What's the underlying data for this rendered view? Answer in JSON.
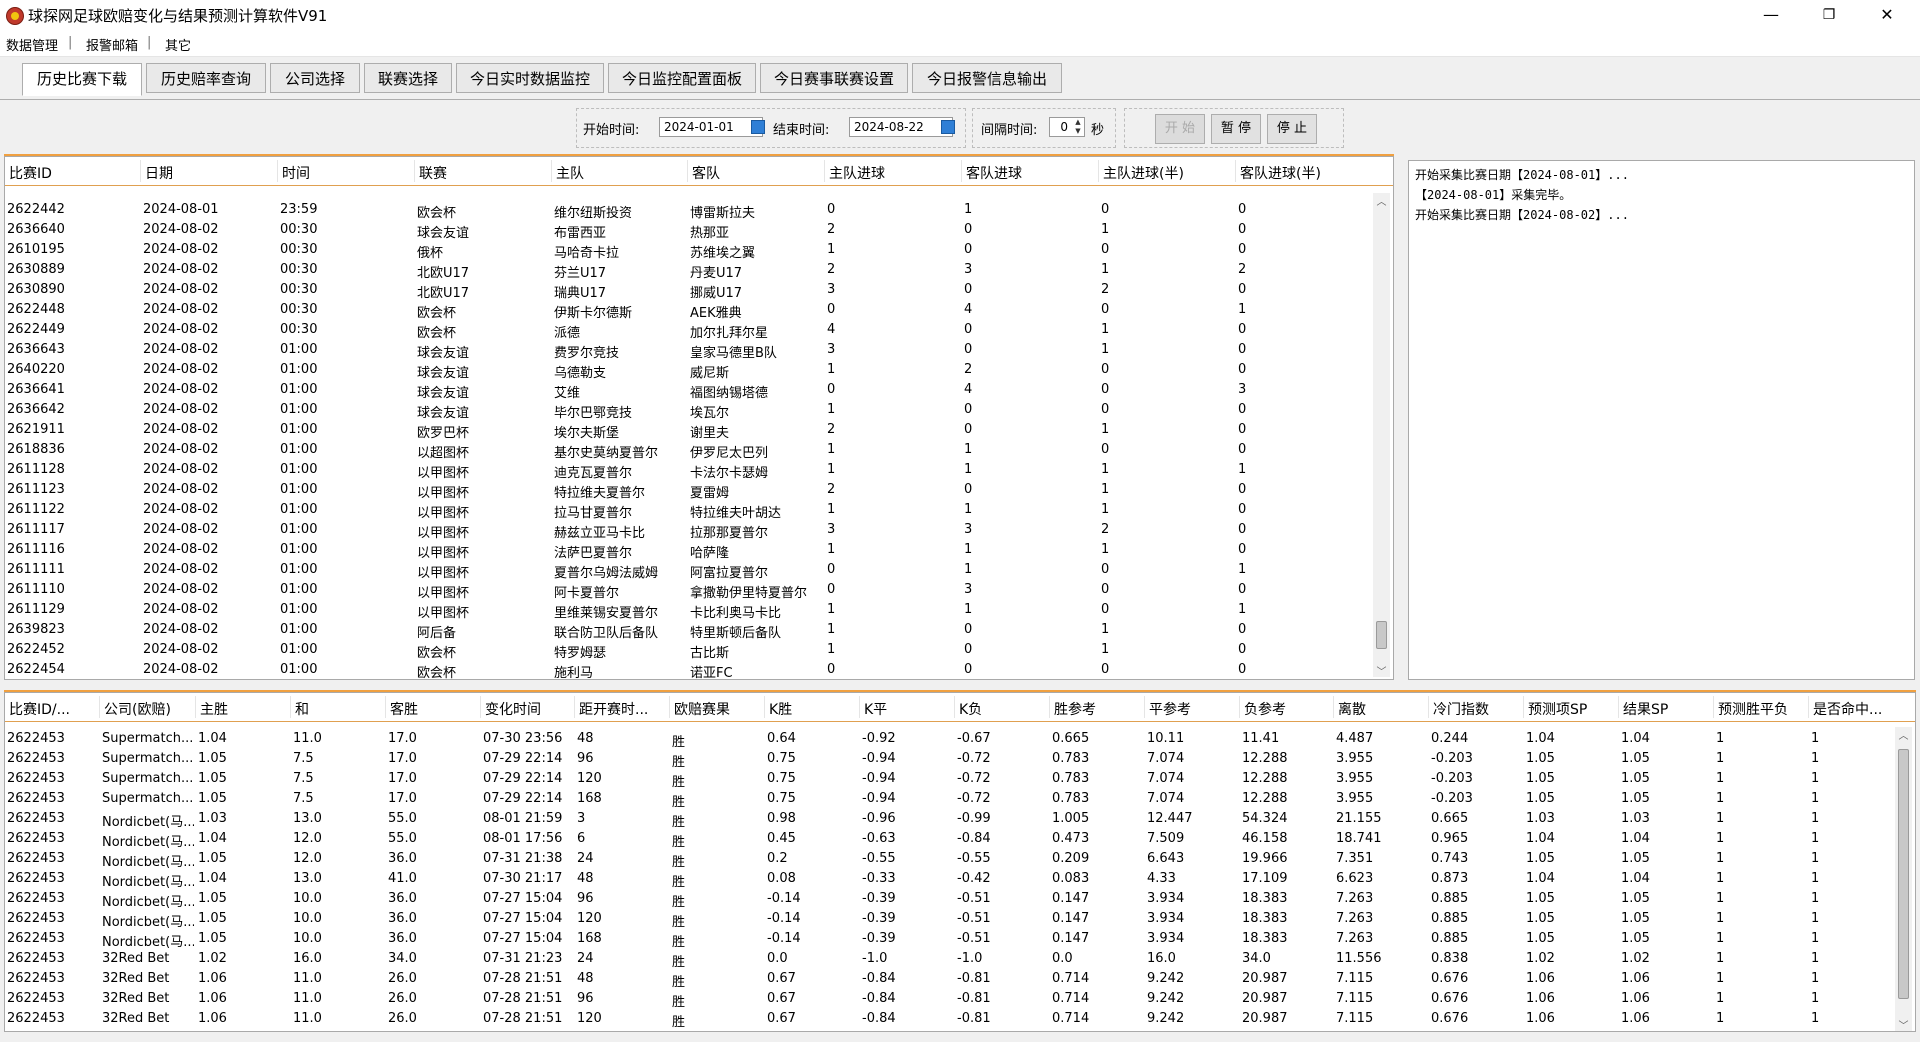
{
  "window": {
    "title": "球探网足球欧赔变化与结果预测计算软件V91",
    "minimize": "—",
    "maximize": "❐",
    "close": "✕"
  },
  "menu": [
    "数据管理",
    "报警邮箱",
    "其它"
  ],
  "menu_separator": "|",
  "tabs": [
    "历史比赛下载",
    "历史赔率查询",
    "公司选择",
    "联赛选择",
    "今日实时数据监控",
    "今日监控配置面板",
    "今日赛事联赛设置",
    "今日报警信息输出"
  ],
  "controls": {
    "start_label": "开始时间:",
    "start_date": "2024-01-01",
    "end_label": "结束时间:",
    "end_date": "2024-08-22",
    "interval_label": "间隔时间:",
    "interval_value": "0",
    "interval_unit": "秒",
    "start_button": "开 始",
    "pause_button": "暂 停",
    "stop_button": "停 止"
  },
  "matches": {
    "columns": [
      "比赛ID",
      "日期",
      "时间",
      "联赛",
      "主队",
      "客队",
      "主队进球",
      "客队进球",
      "主队进球(半)",
      "客队进球(半)"
    ],
    "rows": [
      [
        "2622442",
        "2024-08-01",
        "23:59",
        "欧会杯",
        "维尔纽斯投资",
        "博雷斯拉夫",
        "0",
        "1",
        "0",
        "0"
      ],
      [
        "2636640",
        "2024-08-02",
        "00:30",
        "球会友谊",
        "布雷西亚",
        "热那亚",
        "2",
        "0",
        "1",
        "0"
      ],
      [
        "2610195",
        "2024-08-02",
        "00:30",
        "俄杯",
        "马哈奇卡拉",
        "苏维埃之翼",
        "1",
        "0",
        "0",
        "0"
      ],
      [
        "2630889",
        "2024-08-02",
        "00:30",
        "北欧U17",
        "芬兰U17",
        "丹麦U17",
        "2",
        "3",
        "1",
        "2"
      ],
      [
        "2630890",
        "2024-08-02",
        "00:30",
        "北欧U17",
        "瑞典U17",
        "挪威U17",
        "3",
        "0",
        "2",
        "0"
      ],
      [
        "2622448",
        "2024-08-02",
        "00:30",
        "欧会杯",
        "伊斯卡尔德斯",
        "AEK雅典",
        "0",
        "4",
        "0",
        "1"
      ],
      [
        "2622449",
        "2024-08-02",
        "00:30",
        "欧会杯",
        "派德",
        "加尔扎拜尔星",
        "4",
        "0",
        "1",
        "0"
      ],
      [
        "2636643",
        "2024-08-02",
        "01:00",
        "球会友谊",
        "费罗尔竞技",
        "皇家马德里B队",
        "3",
        "0",
        "1",
        "0"
      ],
      [
        "2640220",
        "2024-08-02",
        "01:00",
        "球会友谊",
        "乌德勒支",
        "威尼斯",
        "1",
        "2",
        "0",
        "0"
      ],
      [
        "2636641",
        "2024-08-02",
        "01:00",
        "球会友谊",
        "艾维",
        "福图纳锡塔德",
        "0",
        "4",
        "0",
        "3"
      ],
      [
        "2636642",
        "2024-08-02",
        "01:00",
        "球会友谊",
        "毕尔巴鄂竞技",
        "埃瓦尔",
        "1",
        "0",
        "0",
        "0"
      ],
      [
        "2621911",
        "2024-08-02",
        "01:00",
        "欧罗巴杯",
        "埃尔夫斯堡",
        "谢里夫",
        "2",
        "0",
        "1",
        "0"
      ],
      [
        "2618836",
        "2024-08-02",
        "01:00",
        "以超图杯",
        "基尔史莫纳夏普尔",
        "伊罗尼太巴列",
        "1",
        "1",
        "0",
        "0"
      ],
      [
        "2611128",
        "2024-08-02",
        "01:00",
        "以甲图杯",
        "迪克瓦夏普尔",
        "卡法尔卡瑟姆",
        "1",
        "1",
        "1",
        "1"
      ],
      [
        "2611123",
        "2024-08-02",
        "01:00",
        "以甲图杯",
        "特拉维夫夏普尔",
        "夏雷姆",
        "2",
        "0",
        "1",
        "0"
      ],
      [
        "2611122",
        "2024-08-02",
        "01:00",
        "以甲图杯",
        "拉马甘夏普尔",
        "特拉维夫叶胡达",
        "1",
        "1",
        "1",
        "0"
      ],
      [
        "2611117",
        "2024-08-02",
        "01:00",
        "以甲图杯",
        "赫兹立亚马卡比",
        "拉那那夏普尔",
        "3",
        "3",
        "2",
        "0"
      ],
      [
        "2611116",
        "2024-08-02",
        "01:00",
        "以甲图杯",
        "法萨巴夏普尔",
        "哈萨隆",
        "1",
        "1",
        "1",
        "0"
      ],
      [
        "2611111",
        "2024-08-02",
        "01:00",
        "以甲图杯",
        "夏普尔乌姆法威姆",
        "阿富拉夏普尔",
        "0",
        "1",
        "0",
        "1"
      ],
      [
        "2611110",
        "2024-08-02",
        "01:00",
        "以甲图杯",
        "阿卡夏普尔",
        "拿撒勒伊里特夏普尔",
        "0",
        "3",
        "0",
        "0"
      ],
      [
        "2611129",
        "2024-08-02",
        "01:00",
        "以甲图杯",
        "里维莱锡安夏普尔",
        "卡比利奥马卡比",
        "1",
        "1",
        "0",
        "1"
      ],
      [
        "2639823",
        "2024-08-02",
        "01:00",
        "阿后备",
        "联合防卫队后备队",
        "特里斯顿后备队",
        "1",
        "0",
        "1",
        "0"
      ],
      [
        "2622452",
        "2024-08-02",
        "01:00",
        "欧会杯",
        "特罗姆瑟",
        "古比斯",
        "1",
        "0",
        "1",
        "0"
      ],
      [
        "2622454",
        "2024-08-02",
        "01:00",
        "欧会杯",
        "施利马",
        "诺亚FC",
        "0",
        "0",
        "0",
        "0"
      ]
    ]
  },
  "log_lines": [
    "开始采集比赛日期【2024-08-01】...",
    "【2024-08-01】采集完毕。",
    "开始采集比赛日期【2024-08-02】..."
  ],
  "odds": {
    "columns": [
      "比赛ID/...",
      "公司(欧赔)",
      "主胜",
      "和",
      "客胜",
      "变化时间",
      "距开赛时...",
      "欧赔赛果",
      "K胜",
      "K平",
      "K负",
      "胜参考",
      "平参考",
      "负参考",
      "离散",
      "冷门指数",
      "预测项SP",
      "结果SP",
      "预测胜平负",
      "是否命中..."
    ],
    "rows": [
      [
        "2622453",
        "Supermatch....",
        "1.04",
        "11.0",
        "17.0",
        "07-30 23:56",
        "48",
        "胜",
        "0.64",
        "-0.92",
        "-0.67",
        "0.665",
        "10.11",
        "11.41",
        "4.487",
        "0.244",
        "1.04",
        "1.04",
        "1",
        "1"
      ],
      [
        "2622453",
        "Supermatch....",
        "1.05",
        "7.5",
        "17.0",
        "07-29 22:14",
        "96",
        "胜",
        "0.75",
        "-0.94",
        "-0.72",
        "0.783",
        "7.074",
        "12.288",
        "3.955",
        "-0.203",
        "1.05",
        "1.05",
        "1",
        "1"
      ],
      [
        "2622453",
        "Supermatch....",
        "1.05",
        "7.5",
        "17.0",
        "07-29 22:14",
        "120",
        "胜",
        "0.75",
        "-0.94",
        "-0.72",
        "0.783",
        "7.074",
        "12.288",
        "3.955",
        "-0.203",
        "1.05",
        "1.05",
        "1",
        "1"
      ],
      [
        "2622453",
        "Supermatch....",
        "1.05",
        "7.5",
        "17.0",
        "07-29 22:14",
        "168",
        "胜",
        "0.75",
        "-0.94",
        "-0.72",
        "0.783",
        "7.074",
        "12.288",
        "3.955",
        "-0.203",
        "1.05",
        "1.05",
        "1",
        "1"
      ],
      [
        "2622453",
        "Nordicbet(马...",
        "1.03",
        "13.0",
        "55.0",
        "08-01 21:59",
        "3",
        "胜",
        "0.98",
        "-0.96",
        "-0.99",
        "1.005",
        "12.447",
        "54.324",
        "21.155",
        "0.665",
        "1.03",
        "1.03",
        "1",
        "1"
      ],
      [
        "2622453",
        "Nordicbet(马...",
        "1.04",
        "12.0",
        "55.0",
        "08-01 17:56",
        "6",
        "胜",
        "0.45",
        "-0.63",
        "-0.84",
        "0.473",
        "7.509",
        "46.158",
        "18.741",
        "0.965",
        "1.04",
        "1.04",
        "1",
        "1"
      ],
      [
        "2622453",
        "Nordicbet(马...",
        "1.05",
        "12.0",
        "36.0",
        "07-31 21:38",
        "24",
        "胜",
        "0.2",
        "-0.55",
        "-0.55",
        "0.209",
        "6.643",
        "19.966",
        "7.351",
        "0.743",
        "1.05",
        "1.05",
        "1",
        "1"
      ],
      [
        "2622453",
        "Nordicbet(马...",
        "1.04",
        "13.0",
        "41.0",
        "07-30 21:17",
        "48",
        "胜",
        "0.08",
        "-0.33",
        "-0.42",
        "0.083",
        "4.33",
        "17.109",
        "6.623",
        "0.873",
        "1.04",
        "1.04",
        "1",
        "1"
      ],
      [
        "2622453",
        "Nordicbet(马...",
        "1.05",
        "10.0",
        "36.0",
        "07-27 15:04",
        "96",
        "胜",
        "-0.14",
        "-0.39",
        "-0.51",
        "0.147",
        "3.934",
        "18.383",
        "7.263",
        "0.885",
        "1.05",
        "1.05",
        "1",
        "1"
      ],
      [
        "2622453",
        "Nordicbet(马...",
        "1.05",
        "10.0",
        "36.0",
        "07-27 15:04",
        "120",
        "胜",
        "-0.14",
        "-0.39",
        "-0.51",
        "0.147",
        "3.934",
        "18.383",
        "7.263",
        "0.885",
        "1.05",
        "1.05",
        "1",
        "1"
      ],
      [
        "2622453",
        "Nordicbet(马...",
        "1.05",
        "10.0",
        "36.0",
        "07-27 15:04",
        "168",
        "胜",
        "-0.14",
        "-0.39",
        "-0.51",
        "0.147",
        "3.934",
        "18.383",
        "7.263",
        "0.885",
        "1.05",
        "1.05",
        "1",
        "1"
      ],
      [
        "2622453",
        "32Red Bet",
        "1.02",
        "16.0",
        "34.0",
        "07-31 21:23",
        "24",
        "胜",
        "0.0",
        "-1.0",
        "-1.0",
        "0.0",
        "16.0",
        "34.0",
        "11.556",
        "0.838",
        "1.02",
        "1.02",
        "1",
        "1"
      ],
      [
        "2622453",
        "32Red Bet",
        "1.06",
        "11.0",
        "26.0",
        "07-28 21:51",
        "48",
        "胜",
        "0.67",
        "-0.84",
        "-0.81",
        "0.714",
        "9.242",
        "20.987",
        "7.115",
        "0.676",
        "1.06",
        "1.06",
        "1",
        "1"
      ],
      [
        "2622453",
        "32Red Bet",
        "1.06",
        "11.0",
        "26.0",
        "07-28 21:51",
        "96",
        "胜",
        "0.67",
        "-0.84",
        "-0.81",
        "0.714",
        "9.242",
        "20.987",
        "7.115",
        "0.676",
        "1.06",
        "1.06",
        "1",
        "1"
      ],
      [
        "2622453",
        "32Red Bet",
        "1.06",
        "11.0",
        "26.0",
        "07-28 21:51",
        "120",
        "胜",
        "0.67",
        "-0.84",
        "-0.81",
        "0.714",
        "9.242",
        "20.987",
        "7.115",
        "0.676",
        "1.06",
        "1.06",
        "1",
        "1"
      ]
    ]
  },
  "scroll_arrows": {
    "up": "︿",
    "down": "﹀"
  }
}
